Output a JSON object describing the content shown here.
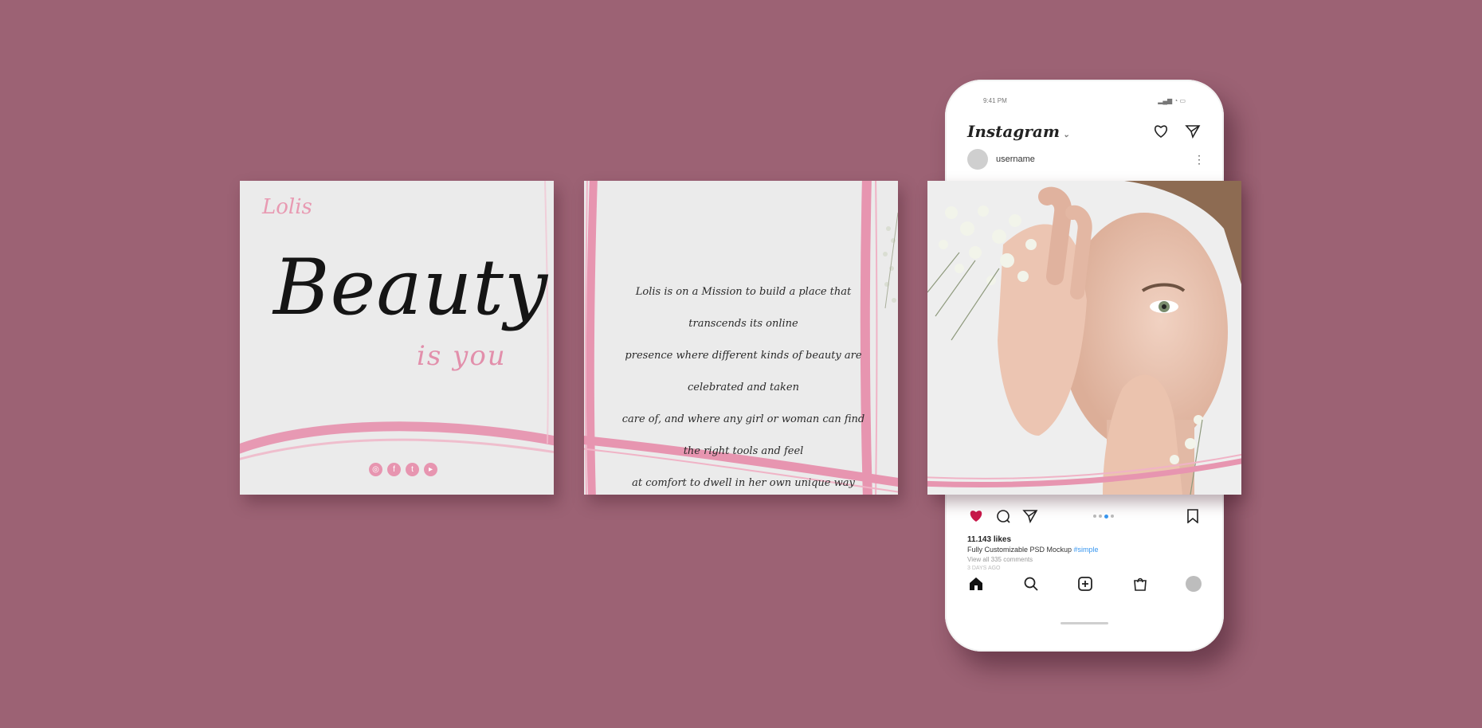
{
  "card1": {
    "logo": "Lolis",
    "headline": "Beauty",
    "subheadline": "is you",
    "social_icons": [
      "instagram-icon",
      "facebook-icon",
      "twitter-icon",
      "youtube-icon"
    ]
  },
  "card2": {
    "lines": [
      "Lolis is on a Mission to build a place that transcends its online",
      "presence where different kinds of beauty are celebrated and taken",
      "care of, and where any girl or woman can find the right tools and feel",
      "at comfort to dwell in her own unique way"
    ]
  },
  "phone": {
    "status_time": "9:41 PM",
    "app_title": "Instagram",
    "username": "username",
    "likes": "11.143 likes",
    "caption_text": "Fully Customizable PSD Mockup ",
    "caption_tag": "#simple",
    "comments_link": "View all 335 comments",
    "time_ago": "3 DAYS AGO"
  },
  "colors": {
    "background": "#9c6274",
    "accent_pink": "#e795b0",
    "like_red": "#c9184a"
  }
}
